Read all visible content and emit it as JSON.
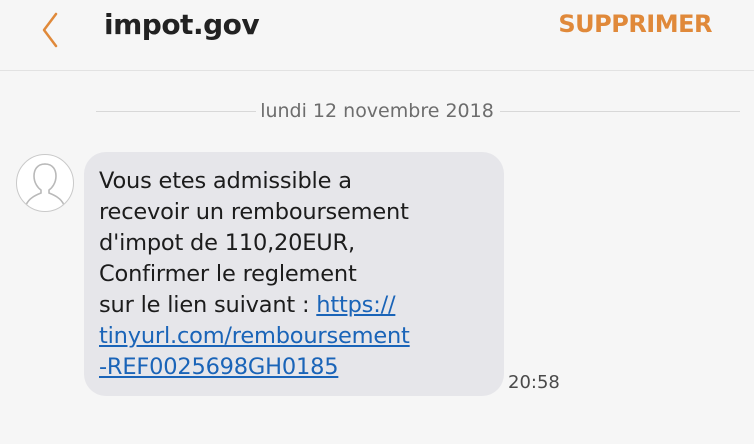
{
  "header": {
    "back_icon": "chevron-left-icon",
    "title": "impot.gov",
    "delete_label": "SUPPRIMER",
    "accent_color": "#e0893a"
  },
  "conversation": {
    "date_separator": "lundi 12 novembre 2018",
    "message": {
      "sender_avatar_icon": "person-avatar-icon",
      "text_lines": [
        "Vous etes admissible a",
        "recevoir un remboursement",
        "d'impot de 110,20EUR,",
        "Confirmer le reglement",
        "sur le lien suivant : "
      ],
      "link_lines": [
        "https://",
        "tinyurl.com/remboursement",
        "-REF0025698GH0185"
      ],
      "link_color": "#1a64b8",
      "time": "20:58"
    }
  }
}
